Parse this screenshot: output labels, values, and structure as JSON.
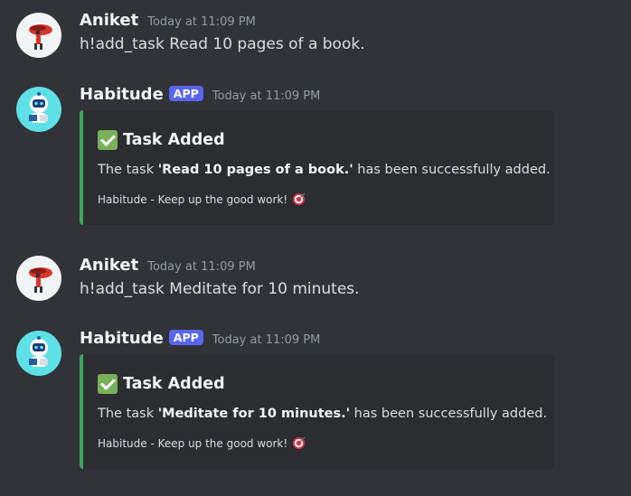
{
  "messages": [
    {
      "author": "Aniket",
      "timestamp": "Today at 11:09 PM",
      "text": "h!add_task Read 10 pages of a book."
    },
    {
      "author": "Habitude",
      "badge": "APP",
      "timestamp": "Today at 11:09 PM",
      "embed": {
        "title": "Task Added",
        "desc_prefix": "The task ",
        "desc_bold": "'Read 10 pages of a book.'",
        "desc_suffix": " has been successfully added.",
        "footer": "Habitude - Keep up the good work!",
        "accent_color": "#3ba55c",
        "title_icon": "check-mark-icon",
        "footer_icon": "target-icon"
      }
    },
    {
      "author": "Aniket",
      "timestamp": "Today at 11:09 PM",
      "text": "h!add_task Meditate for 10 minutes."
    },
    {
      "author": "Habitude",
      "badge": "APP",
      "timestamp": "Today at 11:09 PM",
      "embed": {
        "title": "Task Added",
        "desc_prefix": "The task ",
        "desc_bold": "'Meditate for 10 minutes.'",
        "desc_suffix": " has been successfully added.",
        "footer": "Habitude - Keep up the good work!",
        "accent_color": "#3ba55c",
        "title_icon": "check-mark-icon",
        "footer_icon": "target-icon"
      }
    }
  ],
  "colors": {
    "background": "#313338",
    "embed_background": "#2b2d31",
    "app_badge": "#5865f2",
    "timestamp": "#949ba4"
  }
}
